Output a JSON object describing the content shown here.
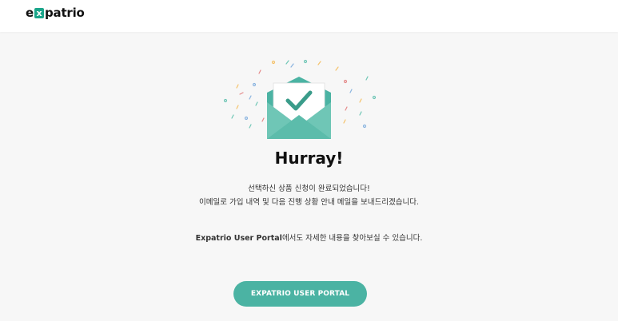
{
  "header": {
    "logo": {
      "prefix": "e",
      "mark": "x",
      "suffix": "patrio"
    }
  },
  "illustration": {
    "icon": "envelope-check-icon",
    "colors": {
      "envelope": "#6fc6b6",
      "envelope_dark": "#4bb3a3",
      "check": "#3a9c8a",
      "confetti": [
        "#f5c26b",
        "#6fc6b6",
        "#e58a8a",
        "#8ab4e0"
      ]
    }
  },
  "title": "Hurray!",
  "message": {
    "line1": "선택하신 상품 신청이 완료되었습니다!",
    "line2": "이메일로 가입 내역 및 다음 진행 상황 안내 메일을 보내드리겠습니다.",
    "brand": "Expatrio User Portal",
    "line3_suffix": "에서도 자세한 내용을 찾아보실 수 있습니다."
  },
  "cta": {
    "label": "EXPATRIO USER PORTAL",
    "color": "#4bb3a3"
  }
}
